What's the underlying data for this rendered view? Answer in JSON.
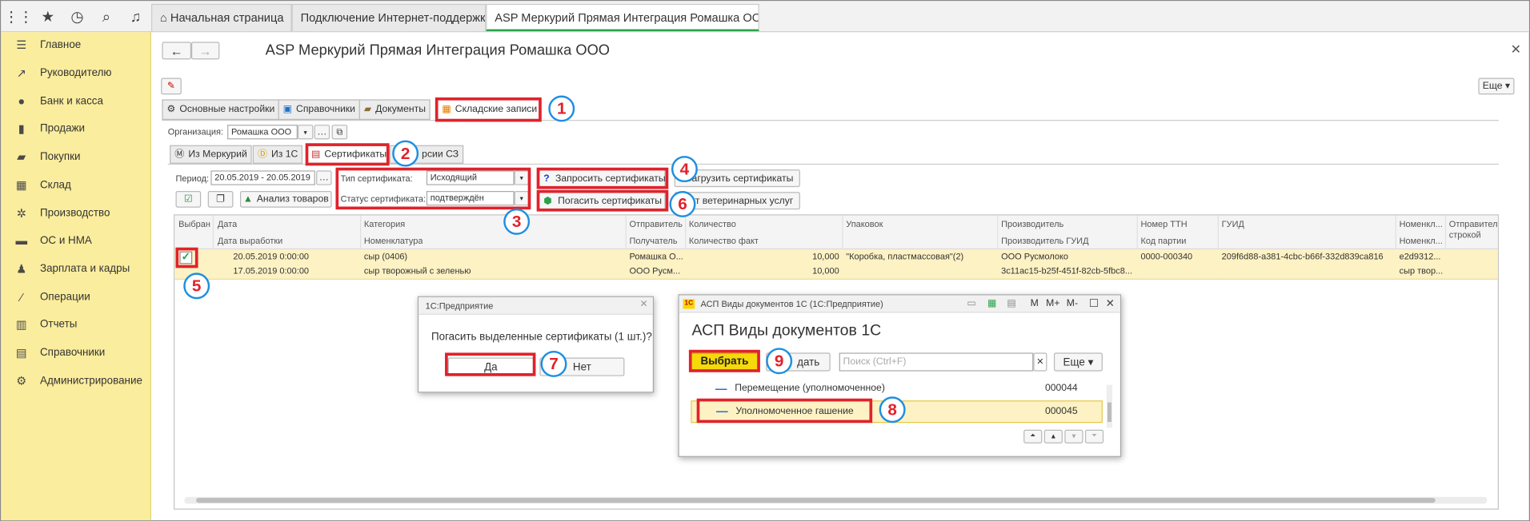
{
  "tabs": [
    "Начальная страница",
    "Подключение Интернет-поддержки",
    "ASP Меркурий Прямая Интеграция Ромашка ООО"
  ],
  "sidebar": [
    "Главное",
    "Руководителю",
    "Банк и касса",
    "Продажи",
    "Покупки",
    "Склад",
    "Производство",
    "ОС и НМА",
    "Зарплата и кадры",
    "Операции",
    "Отчеты",
    "Справочники",
    "Администрирование"
  ],
  "form": {
    "title": "ASP Меркурий Прямая Интеграция Ромашка ООО",
    "more": "Еще",
    "main_tabs": [
      "Основные настройки",
      "Справочники",
      "Документы",
      "Складские записи"
    ],
    "org_label": "Организация:",
    "org_value": "Ромашка ООО",
    "sub_tabs": [
      "Из Меркурий",
      "Из 1С",
      "Сертификаты",
      "рсии СЗ"
    ],
    "period_label": "Период:",
    "period_value": "20.05.2019 - 20.05.2019",
    "cert_type_label": "Тип сертификата:",
    "cert_type_value": "Исходящий",
    "cert_status_label": "Статус сертификата:",
    "cert_status_value": "подтверждён",
    "btn_request": "Запросить сертификаты",
    "btn_load": "Загрузить сертификаты",
    "btn_repay": "Погасить сертификаты",
    "btn_vet": "Акт ветеринарных услуг",
    "btn_analysis": "Анализ товаров"
  },
  "table": {
    "headers1": [
      "Выбран",
      "Дата",
      "Категория",
      "Отправитель",
      "Количество",
      "Упаковок",
      "Производитель",
      "Номер ТТН",
      "ГУИД",
      "Номенкл...",
      "Отправитель строкой"
    ],
    "headers2": [
      "Дата выработки",
      "Номенклатура",
      "Получатель",
      "Количество факт",
      "Производитель ГУИД",
      "Код партии",
      "Номенкл..."
    ],
    "row1": {
      "date": "20.05.2019 0:00:00",
      "category": "сыр (0406)",
      "sender": "Ромашка О...",
      "qty": "10,000",
      "pack": "\"Коробка, пластмассовая\"(2)",
      "producer": "ООО Русмолоко",
      "ttn": "0000-000340",
      "guid": "209f6d88-a381-4cbc-b66f-332d839ca816",
      "nom": "e2d9312..."
    },
    "row2": {
      "date": "17.05.2019 0:00:00",
      "nomen": "сыр творожный с зеленью",
      "receiver": "ООО Русм...",
      "qty": "10,000",
      "producer_guid": "3c11ac15-b25f-451f-82cb-5fbc8...",
      "nom": "сыр твор..."
    }
  },
  "confirm": {
    "title": "1С:Предприятие",
    "message": "Погасить выделенные сертификаты (1 шт.)?",
    "yes": "Да",
    "no": "Нет"
  },
  "doc_dialog": {
    "title": "АСП Виды документов 1С (1С:Предприятие)",
    "heading": "АСП Виды документов 1С",
    "select": "Выбрать",
    "create": "дать",
    "search_placeholder": "Поиск (Ctrl+F)",
    "more": "Еще",
    "mplus": "M+",
    "m": "M",
    "mminus": "M-",
    "items": [
      {
        "name": "Перемещение (уполномоченное)",
        "code": "000044"
      },
      {
        "name": "Уполномоченное гашение",
        "code": "000045"
      }
    ]
  },
  "markers": [
    "1",
    "2",
    "3",
    "4",
    "5",
    "6",
    "7",
    "8",
    "9"
  ],
  "colors": {
    "sidebar": "#fbed9e",
    "highlight": "#fdf2c4",
    "red": "#e0222b",
    "blue": "#1e8fe0",
    "select_btn": "#f5d90a"
  }
}
